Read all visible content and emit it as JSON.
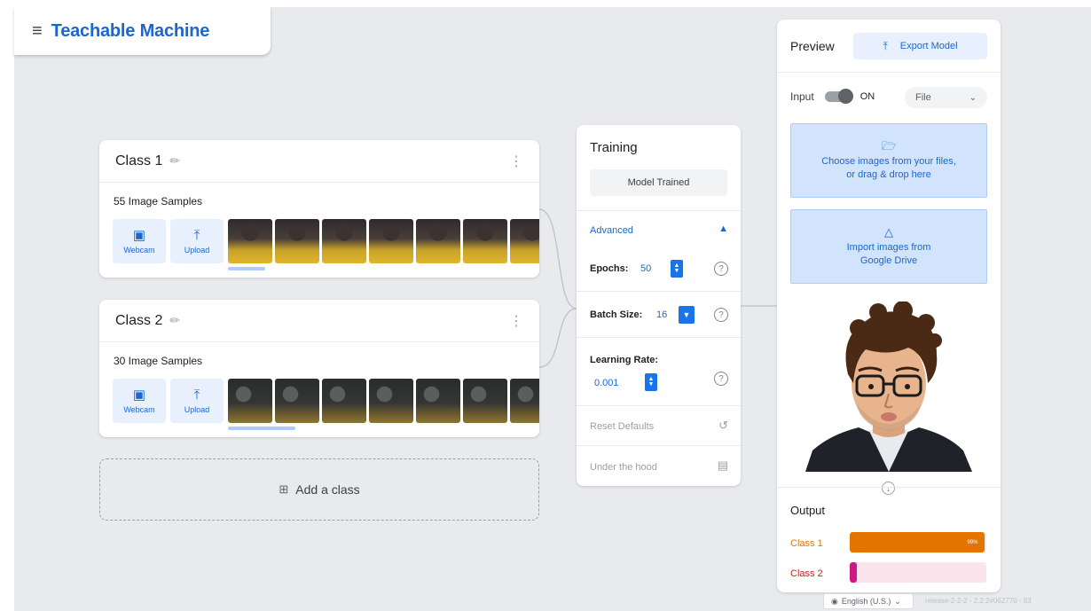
{
  "app": {
    "title": "Teachable Machine",
    "menu_icon": "hamburger-icon"
  },
  "classes": [
    {
      "name": "Class 1",
      "samples_text": "55 Image Samples",
      "webcam_label": "Webcam",
      "upload_label": "Upload"
    },
    {
      "name": "Class 2",
      "samples_text": "30 Image Samples",
      "webcam_label": "Webcam",
      "upload_label": "Upload"
    }
  ],
  "add_class": {
    "label": "Add a class"
  },
  "training": {
    "title": "Training",
    "status_button": "Model Trained",
    "advanced_label": "Advanced",
    "epochs_label": "Epochs:",
    "epochs_value": "50",
    "batch_label": "Batch Size:",
    "batch_value": "16",
    "lr_label": "Learning Rate:",
    "lr_value": "0.001",
    "reset_label": "Reset Defaults",
    "hood_label": "Under the hood"
  },
  "preview": {
    "title": "Preview",
    "export_label": "Export Model",
    "input_label": "Input",
    "toggle_state": "ON",
    "source_select": "File",
    "file_drop_line1": "Choose images from your files,",
    "file_drop_line2": "or drag & drop here",
    "drive_line1": "Import images from",
    "drive_line2": "Google Drive",
    "output_title": "Output",
    "outputs": [
      {
        "label": "Class 1",
        "percent_text": "99%",
        "confidence": 0.99,
        "color": "#e37400",
        "track": "#fce8e6",
        "label_color": "#e37400"
      },
      {
        "label": "Class 2",
        "percent_text": "",
        "confidence": 0.01,
        "color": "#d01884",
        "track": "#fce4ec",
        "label_color": "#c5221f"
      }
    ]
  },
  "footer": {
    "language": "English (U.S.)",
    "release": "release-2-2-2 - 2.2.2#062770 - 83"
  },
  "colors": {
    "accent": "#1a73e8",
    "accent_light": "#e8f0fe",
    "canvas": "#e8eaed"
  }
}
